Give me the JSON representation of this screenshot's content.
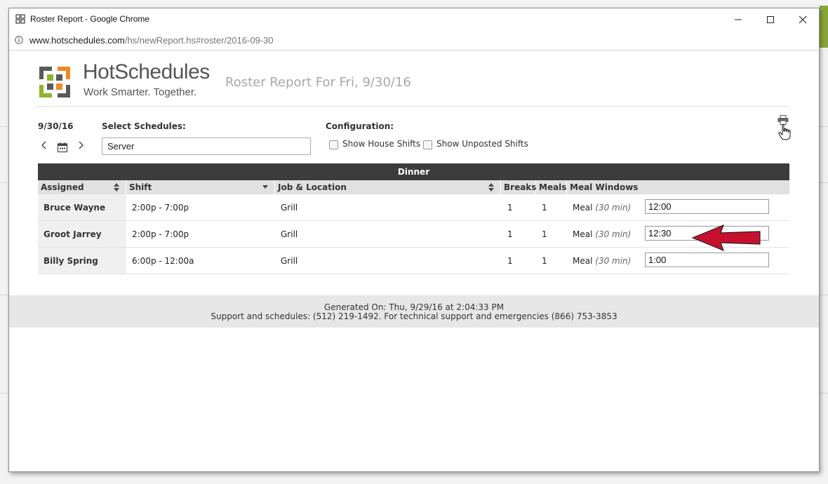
{
  "window": {
    "title": "Roster Report - Google Chrome",
    "url_host": "www.hotschedules.com",
    "url_path": "/hs/newReport.hs#roster/2016-09-30"
  },
  "logo": {
    "name": "HotSchedules",
    "tagline": "Work Smarter. Together."
  },
  "report": {
    "title": "Roster Report For Fri, 9/30/16"
  },
  "controls": {
    "date": "9/30/16",
    "schedules_label": "Select Schedules:",
    "schedules_value": "Server",
    "config_label": "Configuration:",
    "show_house_shifts": "Show House Shifts",
    "show_unposted_shifts": "Show Unposted Shifts"
  },
  "table": {
    "section": "Dinner",
    "columns": {
      "assigned": "Assigned",
      "shift": "Shift",
      "job_location": "Job & Location",
      "breaks": "Breaks",
      "meals": "Meals",
      "meal_windows": "Meal Windows"
    },
    "rows": [
      {
        "name": "Bruce Wayne",
        "shift": "2:00p - 7:00p",
        "job": "Grill",
        "breaks": "1",
        "meals": "1",
        "meal": "Meal",
        "duration": "(30 min)",
        "window": "12:00"
      },
      {
        "name": "Groot Jarrey",
        "shift": "2:00p - 7:00p",
        "job": "Grill",
        "breaks": "1",
        "meals": "1",
        "meal": "Meal",
        "duration": "(30 min)",
        "window": "12:30"
      },
      {
        "name": "Billy Spring",
        "shift": "6:00p - 12:00a",
        "job": "Grill",
        "breaks": "1",
        "meals": "1",
        "meal": "Meal",
        "duration": "(30 min)",
        "window": "1:00"
      }
    ]
  },
  "footer": {
    "generated": "Generated On: Thu, 9/29/16 at 2:04:33 PM",
    "support": "Support and schedules: (512) 219-1492. For technical support and emergencies (866) 753-3853"
  },
  "colors": {
    "accent_arrow": "#c8102e",
    "section_header": "#3c3c3c",
    "logo_green": "#8cb42c",
    "logo_orange": "#f08a24",
    "logo_gray": "#5a5a5a"
  }
}
